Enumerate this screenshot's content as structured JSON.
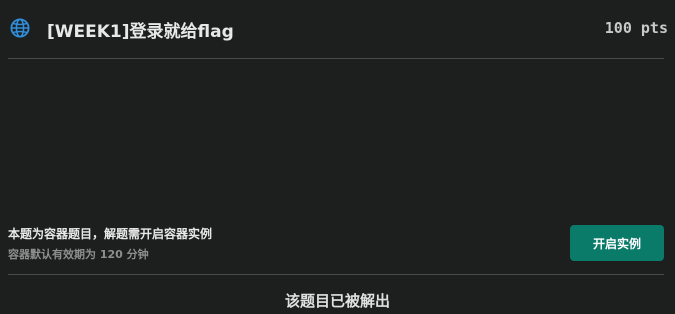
{
  "challenge": {
    "title": "[WEEK1]登录就给flag",
    "points": "100 pts",
    "icon": "globe-icon",
    "icon_color": "#2f8fdc"
  },
  "container": {
    "message": "本题为容器题目，解题需开启容器实例",
    "validity": "容器默认有效期为 120 分钟",
    "start_button_label": "开启实例",
    "button_color": "#0a7a69"
  },
  "status": {
    "solved_text": "该题目已被解出"
  }
}
